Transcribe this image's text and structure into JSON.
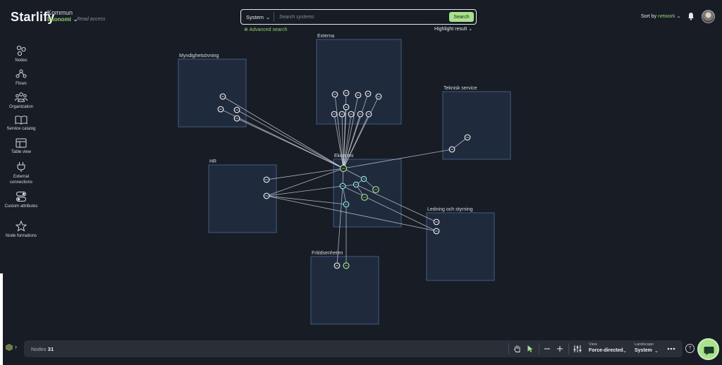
{
  "header": {
    "brand": "Starlify",
    "org_name": "Kommun",
    "workspace": "Ekonomi",
    "access": "Read access"
  },
  "search": {
    "type_label": "System",
    "placeholder": "Search systems",
    "button_label": "Search",
    "advanced_label": "Advanced search",
    "highlight_label": "Highlight result"
  },
  "sort": {
    "prefix": "Sort by",
    "value": "network"
  },
  "sidebar": {
    "items": [
      {
        "label": "Nodes",
        "icon": "nodes-icon"
      },
      {
        "label": "Flows",
        "icon": "flows-icon"
      },
      {
        "label": "Organization",
        "icon": "organization-icon"
      },
      {
        "label": "Service catalog",
        "icon": "service-catalog-icon"
      },
      {
        "label": "Table view",
        "icon": "table-view-icon"
      },
      {
        "label": "External connections",
        "icon": "external-connections-icon"
      },
      {
        "label": "Custom attributes",
        "icon": "custom-attributes-icon"
      },
      {
        "label": "Node formations",
        "icon": "node-formations-icon"
      }
    ]
  },
  "graph": {
    "groups": [
      "Myndighetsövning",
      "Externa",
      "Teknisk service",
      "Ekonomi",
      "HR",
      "Ledning och styrning",
      "Fritidsenheten"
    ]
  },
  "bottom": {
    "nodes_label": "Nodes",
    "nodes_count": "31",
    "view_label": "View",
    "view_value": "Force-directed",
    "landscape_label": "Landscape",
    "landscape_value": "System",
    "help": "?"
  },
  "colors": {
    "accent": "#a8e28d",
    "node_green": "#a8e28d",
    "node_cyan": "#8fe0e8",
    "background": "#181c24"
  }
}
